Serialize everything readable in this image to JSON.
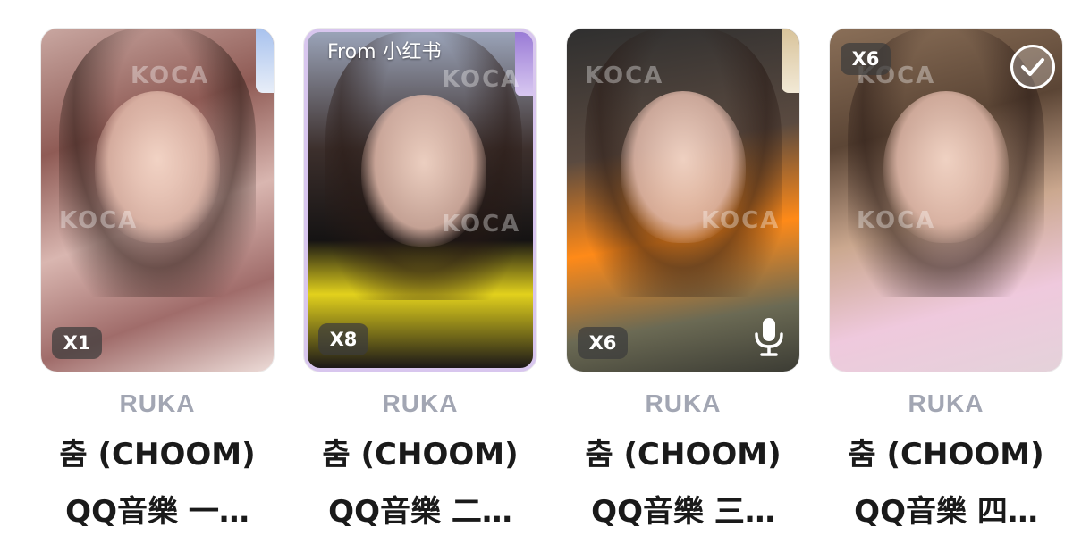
{
  "cards": [
    {
      "qty": "X1",
      "source": "",
      "artist": "RUKA",
      "title_line1": "춤 (CHOOM)",
      "title_line2": "QQ音樂 一…"
    },
    {
      "qty": "X8",
      "source": "From 小红书",
      "artist": "RUKA",
      "title_line1": "춤 (CHOOM)",
      "title_line2": "QQ音樂 二…"
    },
    {
      "qty": "X6",
      "source": "",
      "artist": "RUKA",
      "title_line1": "춤 (CHOOM)",
      "title_line2": "QQ音樂 三…"
    },
    {
      "qty": "X6",
      "source": "",
      "artist": "RUKA",
      "title_line1": "춤 (CHOOM)",
      "title_line2": "QQ音樂 四…"
    }
  ],
  "watermark": "KOCA",
  "icons": [
    "check-icon",
    "microphone-icon"
  ]
}
